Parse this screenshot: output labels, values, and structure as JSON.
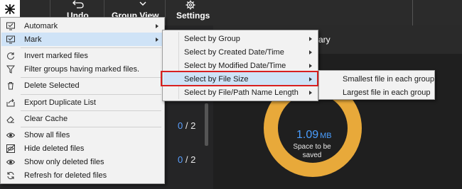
{
  "toolbar": {
    "undo_label": "Undo",
    "group_view_label": "Group View",
    "settings_label": "Settings"
  },
  "left_panel": {
    "rows": [
      {
        "marked": "0",
        "separator": " / ",
        "total": "2"
      },
      {
        "marked": "0",
        "separator": " / ",
        "total": "2"
      }
    ]
  },
  "summary": {
    "title_partial": "ary",
    "space_value": "1.09",
    "space_unit": "MB",
    "space_caption": "Space to be saved",
    "donut_color": "#e8a93a",
    "value_color": "#4a9eff"
  },
  "main_menu": {
    "items": [
      {
        "label": "Automark",
        "icon": "automark-icon",
        "submenu": true
      },
      {
        "label": "Mark",
        "icon": "mark-icon",
        "submenu": true
      },
      {
        "label": "Invert marked files",
        "icon": "invert-icon"
      },
      {
        "label": "Filter groups having marked files.",
        "icon": "filter-icon"
      },
      {
        "label": "Delete Selected",
        "icon": "trash-icon"
      },
      {
        "label": "Export Duplicate List",
        "icon": "export-icon"
      },
      {
        "label": "Clear Cache",
        "icon": "eraser-icon"
      },
      {
        "label": "Show all files",
        "icon": "eye-icon"
      },
      {
        "label": "Hide deleted files",
        "icon": "eye-slash-icon"
      },
      {
        "label": "Show only deleted files",
        "icon": "eye-icon"
      },
      {
        "label": "Refresh for deleted files",
        "icon": "refresh-icon"
      }
    ]
  },
  "mark_submenu": {
    "items": [
      {
        "label": "Select by Group"
      },
      {
        "label": "Select by Created Date/Time"
      },
      {
        "label": "Select by Modified Date/Time"
      },
      {
        "label": "Select by File Size"
      },
      {
        "label": "Select by File/Path Name Length"
      }
    ]
  },
  "size_submenu": {
    "items": [
      {
        "label": "Smallest file in each group"
      },
      {
        "label": "Largest file in each group"
      }
    ]
  },
  "colors": {
    "menu_hover": "#cfe3f7",
    "highlight_border": "#d82020"
  }
}
